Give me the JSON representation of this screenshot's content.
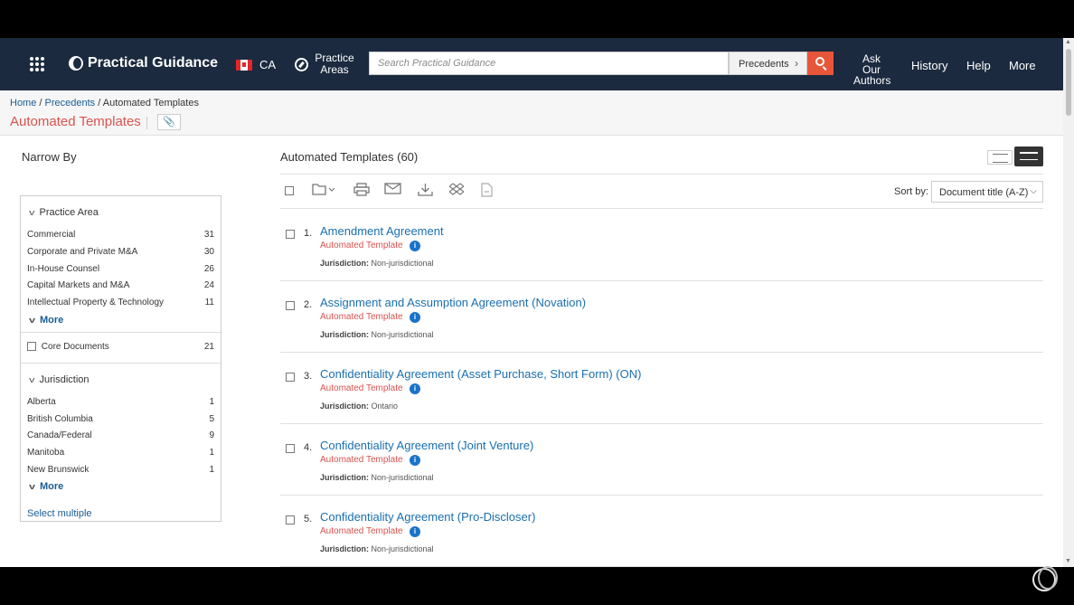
{
  "header": {
    "brand": "Practical Guidance",
    "country": "CA",
    "practice_areas": "Practice Areas",
    "search_placeholder": "Search Practical Guidance",
    "search_scope": "Precedents",
    "nav": {
      "ask_authors": "Ask Our Authors",
      "history": "History",
      "help": "Help",
      "more": "More"
    }
  },
  "breadcrumb": {
    "home": "Home",
    "sep1": "/",
    "precedents": "Precedents",
    "sep2": "/",
    "current": "Automated Templates"
  },
  "page_title": "Automated Templates",
  "sidebar": {
    "heading": "Narrow By",
    "practice_area": {
      "label": "Practice Area",
      "items": [
        {
          "label": "Commercial",
          "count": "31"
        },
        {
          "label": "Corporate and Private M&A",
          "count": "30"
        },
        {
          "label": "In-House Counsel",
          "count": "26"
        },
        {
          "label": "Capital Markets and M&A",
          "count": "24"
        },
        {
          "label": "Intellectual Property & Technology",
          "count": "11"
        }
      ],
      "more": "More"
    },
    "core_documents": {
      "label": "Core Documents",
      "count": "21"
    },
    "jurisdiction": {
      "label": "Jurisdiction",
      "items": [
        {
          "label": "Alberta",
          "count": "1"
        },
        {
          "label": "British Columbia",
          "count": "5"
        },
        {
          "label": "Canada/Federal",
          "count": "9"
        },
        {
          "label": "Manitoba",
          "count": "1"
        },
        {
          "label": "New Brunswick",
          "count": "1"
        }
      ],
      "more": "More"
    },
    "select_multiple": "Select multiple"
  },
  "results": {
    "title": "Automated Templates (60)",
    "sort_label": "Sort by:",
    "sort_value": "Document title (A-Z)",
    "jurisdiction_label": "Jurisdiction:",
    "items": [
      {
        "num": "1.",
        "title": "Amendment Agreement",
        "type": "Automated Template",
        "jurisdiction": "Non-jurisdictional"
      },
      {
        "num": "2.",
        "title": "Assignment and Assumption Agreement (Novation)",
        "type": "Automated Template",
        "jurisdiction": "Non-jurisdictional"
      },
      {
        "num": "3.",
        "title": "Confidentiality Agreement (Asset Purchase, Short Form) (ON)",
        "type": "Automated Template",
        "jurisdiction": "Ontario"
      },
      {
        "num": "4.",
        "title": "Confidentiality Agreement (Joint Venture)",
        "type": "Automated Template",
        "jurisdiction": "Non-jurisdictional"
      },
      {
        "num": "5.",
        "title": "Confidentiality Agreement (Pro-Discloser)",
        "type": "Automated Template",
        "jurisdiction": "Non-jurisdictional"
      }
    ]
  },
  "icons": [
    "apps-grid-icon",
    "compass-icon",
    "search-icon",
    "folder-icon",
    "print-icon",
    "email-icon",
    "download-icon",
    "dropbox-icon",
    "document-icon",
    "info-icon",
    "paperclip-icon"
  ],
  "colors": {
    "header_bg": "#1b2a3f",
    "accent_red": "#d9534f",
    "link_blue": "#1a6fb0",
    "search_btn": "#e8563a"
  }
}
